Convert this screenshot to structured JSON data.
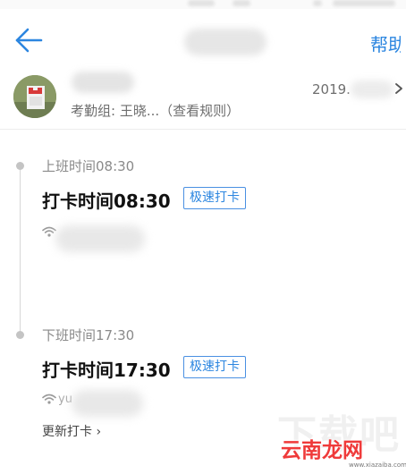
{
  "header": {
    "help_label": "帮助"
  },
  "profile": {
    "group_label": "考勤组: 王晓...",
    "rules_link": "（查看规则）",
    "date": "2019."
  },
  "records": [
    {
      "schedule": "上班时间08:30",
      "punch": "打卡时间08:30",
      "tag": "极速打卡",
      "wifi_prefix": ""
    },
    {
      "schedule": "下班时间17:30",
      "punch": "打卡时间17:30",
      "tag": "极速打卡",
      "wifi_prefix": "yu"
    }
  ],
  "update_link": "更新打卡 ›",
  "watermark": {
    "ghost": "下载吧",
    "main": "云南龙网",
    "sub": "www.xiazaiba.com"
  },
  "colors": {
    "accent": "#2c86e0",
    "tag_border": "#4a90e2",
    "watermark_red": "#ef3a3a"
  },
  "icons": [
    "back-arrow-icon",
    "chevron-right-icon",
    "wifi-icon"
  ]
}
